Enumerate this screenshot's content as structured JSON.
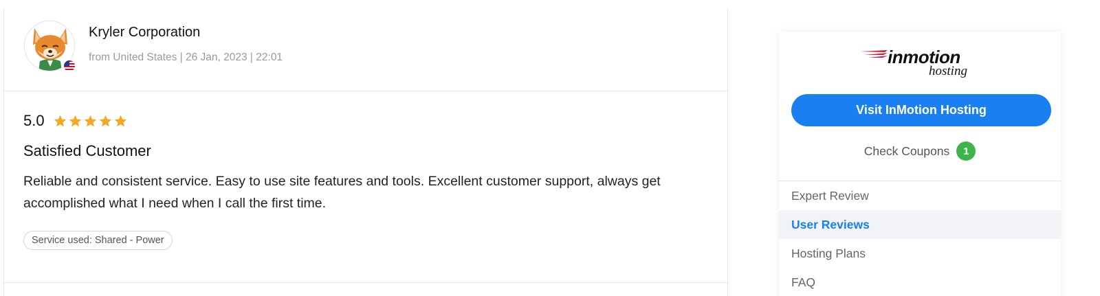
{
  "review": {
    "reviewer_name": "Kryler Corporation",
    "reviewer_meta": "from United States | 26 Jan, 2023 | 22:01",
    "avatar_icon": "fox-avatar-icon",
    "flag_icon": "us-flag-icon",
    "rating": "5.0",
    "stars": 5,
    "star_color": "#f5a623",
    "title": "Satisfied Customer",
    "text": "Reliable and consistent service. Easy to use site features and tools. Excellent customer support, always get accomplished what I need when I call the first time.",
    "service_tag": "Service used: Shared - Power"
  },
  "sidebar": {
    "logo_main": "inmotion",
    "logo_sub": "hosting",
    "visit_button": "Visit InMotion Hosting",
    "coupons_label": "Check Coupons",
    "coupons_count": "1",
    "accent_color": "#1a7ff0",
    "badge_color": "#3cb54a",
    "nav_items": [
      {
        "label": "Expert Review",
        "active": false
      },
      {
        "label": "User Reviews",
        "active": true
      },
      {
        "label": "Hosting Plans",
        "active": false
      },
      {
        "label": "FAQ",
        "active": false
      }
    ]
  }
}
